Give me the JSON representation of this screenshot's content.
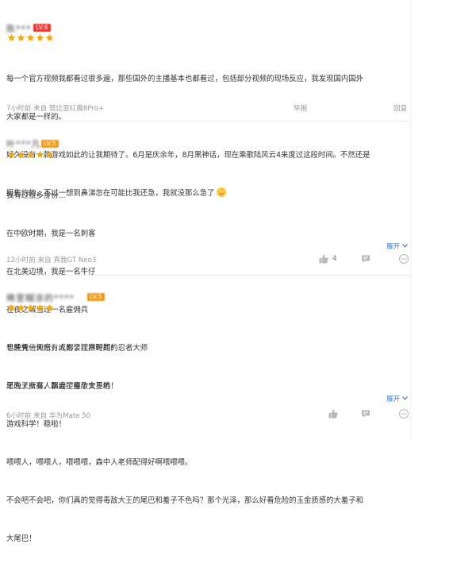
{
  "colors": {
    "star": "#f2a71b",
    "badge_red": "#e8322a",
    "badge_orange": "#f29a18",
    "link_blue": "#3a7bd5",
    "meta_gray": "#999999",
    "icon_gray": "#b8b8b8"
  },
  "icons": {
    "star": "star-icon",
    "like": "thumb-up-icon",
    "comment": "comment-bubble-icon",
    "expand": "chevron-down-icon"
  },
  "comments": [
    {
      "username": "陈***",
      "badge": "LV.6",
      "badge_color": "#e8322a",
      "rating": 5,
      "lines": [
        "每一个官方视频我都看过很多遍，那些国外的主播基本也都看过，包括部分视频的现场反应，我发现国内国外",
        "大家都是一样的。",
        "好久没有一款游戏如此的让我期待了。6月是庆余年，8月黑神话，现在乘歌陆风云4来度过这段时间。不然还是",
        "挺焦灼的，不过一想到鼻涕忽在可能比我还急，我就没那么急了"
      ],
      "meta": "7小时前 来自 努比亚红魔8Pro+",
      "actions": {
        "report": "举报",
        "reply": "回复"
      }
    },
    {
      "username": "叶***凡",
      "badge": "LV.5",
      "badge_color": "#f29a18",
      "rating": 5,
      "lines": [
        "我有过很多身份...",
        "在中欧时期，我是一名刺客",
        "在北美边境，我是一名牛仔",
        "在夜之城当过一名雇佣兵",
        "也凭凭信仰念，成为了江户时期的忍者大师",
        "还为了女巫，飘遍了整个交界地"
      ],
      "expand_label": "展开",
      "meta": "12小时前 来自 真我GT Neo3",
      "likes": "4"
    },
    {
      "username": "稀里糊涂的****",
      "badge": "LV.5",
      "badge_color": "#f29a18",
      "rating": 5,
      "lines": [
        "早晚有一天所有人都会控猴哥的！",
        "早晚天所有人都会控毒敌大王的！",
        "游戏科学！稳啦！",
        "喂喂人，喂喂人，喂喂喂，森中人老师配得好啊喂喂喂。",
        "不会吧不会吧，你们真的觉得毒敌大王的尾巴和羞子不色吗？那个光泽，那么好看危险的玉金质感的大羞子和",
        "大尾巴！"
      ],
      "expand_label": "展开",
      "meta": "6小时前 来自 华为Mate 50"
    }
  ]
}
